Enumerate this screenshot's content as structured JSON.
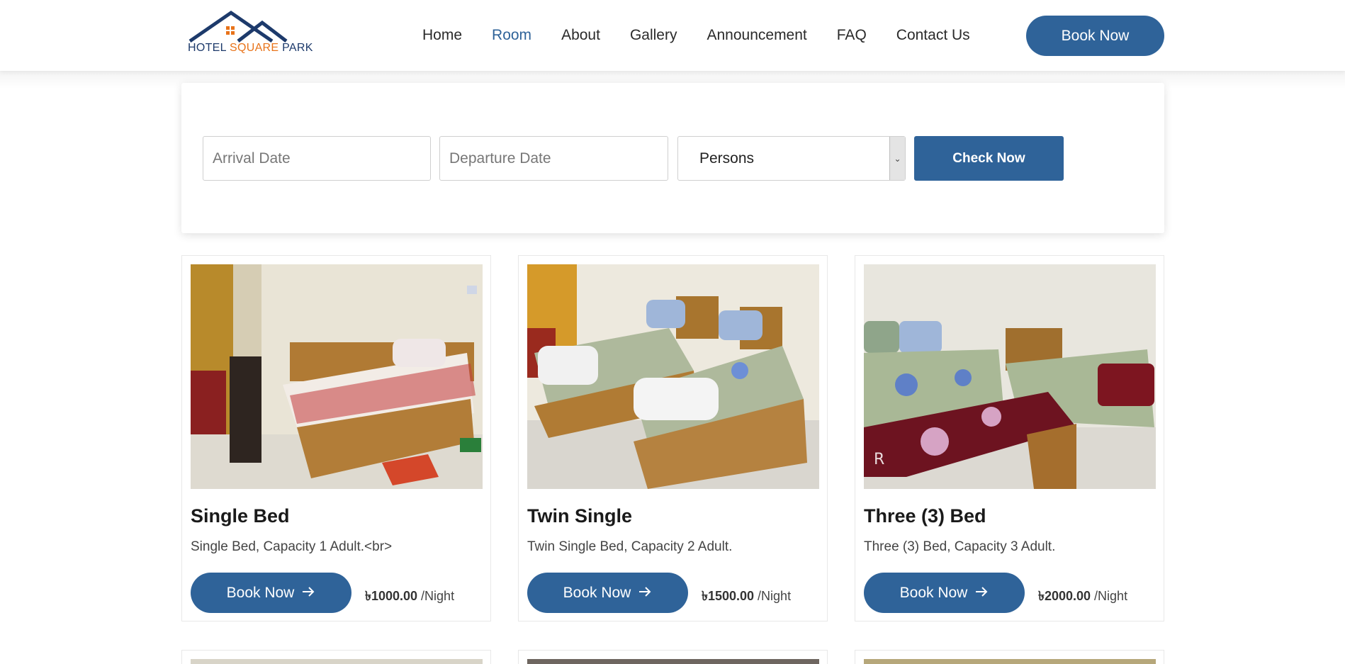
{
  "logo": {
    "word1": "HOTEL",
    "word2": "SQUARE",
    "word3": "PARK",
    "icon": "house-roofs-logo"
  },
  "nav": {
    "items": [
      "Home",
      "Room",
      "About",
      "Gallery",
      "Announcement",
      "FAQ",
      "Contact Us"
    ],
    "active": "Room",
    "book_now": "Book Now"
  },
  "booking_form": {
    "arrival_placeholder": "Arrival Date",
    "departure_placeholder": "Departure Date",
    "persons_value": "Persons",
    "check_label": "Check Now"
  },
  "rooms": [
    {
      "title": "Single Bed",
      "description": "Single Bed, Capacity 1 Adult.<br>",
      "button": "Book Now",
      "price": "৳1000.00",
      "unit": "/Night"
    },
    {
      "title": "Twin Single",
      "description": "Twin Single Bed, Capacity 2 Adult.",
      "button": "Book Now",
      "price": "৳1500.00",
      "unit": "/Night"
    },
    {
      "title": "Three (3) Bed",
      "description": "Three (3) Bed, Capacity 3 Adult.",
      "button": "Book Now",
      "price": "৳2000.00",
      "unit": "/Night"
    }
  ],
  "colors": {
    "accent": "#2f6399",
    "logo_blue": "#1d3a6b",
    "logo_orange": "#e8731a"
  },
  "icons": {
    "arrow": "arrow-right-icon",
    "select": "chevron-down-icon"
  }
}
